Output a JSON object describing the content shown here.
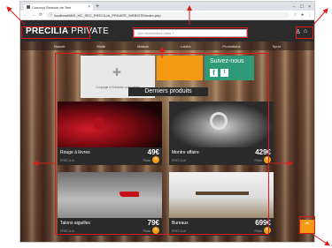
{
  "browser": {
    "tab_title": "Concept Session de Test",
    "tab_close": "×",
    "new_tab": "+",
    "back": "←",
    "forward": "→",
    "reload": "⟳",
    "info": "ⓘ",
    "url": "localhost/MIS_HC_SEC_PRECILIA_PRIVATE_WEBSITE/index.php",
    "minimize": "–",
    "maximize": "☐",
    "close": "×",
    "star": "☆",
    "profile": "●",
    "menu": "⋮"
  },
  "header": {
    "logo_part1": "PRECILIA",
    "logo_part2": "PRIVATE",
    "search_placeholder": "Que recherchez-vous ?",
    "icon_user": "♙",
    "icon_cart": "⌂"
  },
  "nav": {
    "items": [
      "Nouvel",
      "Mode",
      "Maison",
      "Loisirs",
      "Promotions",
      "Sport"
    ]
  },
  "promo": {
    "caption": "Coupage à l'intoiane compatible",
    "follow_title": "Suivez-nous",
    "facebook": "f",
    "twitter": "t"
  },
  "section": {
    "title": "Derniers produits"
  },
  "products": [
    {
      "name": "Rouge à lèvres",
      "price": "49€",
      "brand": "PRECILIA",
      "sub": "Fiche"
    },
    {
      "name": "Montre affaire",
      "price": "429€",
      "brand": "PRECILIA",
      "sub": "Fiche"
    },
    {
      "name": "Talons aiguilles",
      "price": "79€",
      "brand": "PRECILIA",
      "sub": "Fiche"
    },
    {
      "name": "Bureaux",
      "price": "699€",
      "brand": "PRECILIA",
      "sub": "Fiche"
    }
  ],
  "card_plus": "+",
  "scroll_top": "⌃",
  "colors": {
    "accent": "#f39a12",
    "social": "#2e9a78",
    "header": "#2b2b2b",
    "highlight": "#e01a1a"
  }
}
